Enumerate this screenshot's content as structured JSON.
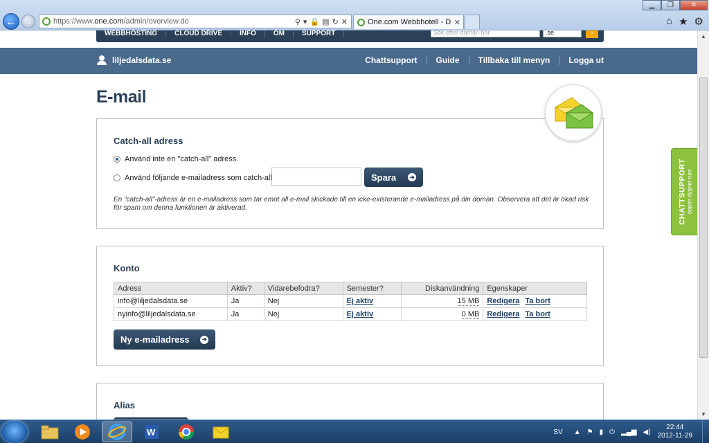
{
  "browser": {
    "url_prefix": "https://www.",
    "url_domain": "one.com",
    "url_path": "/admin/overview.do",
    "tab_title": "One.com Webbhotell - Do...",
    "back_icon": "back-arrow-icon",
    "forward_icon": "forward-arrow-icon"
  },
  "topnav": {
    "items": [
      "WEBBHOSTING",
      "CLOUD DRIVE",
      "INFO",
      "OM",
      "SUPPORT"
    ],
    "search_placeholder": "Sök efter domän här",
    "tld_value": ".se"
  },
  "userbar": {
    "domain": "liljedalsdata.se",
    "links": [
      "Chattsupport",
      "Guide",
      "Tillbaka till menyn",
      "Logga ut"
    ]
  },
  "page": {
    "title": "E-mail"
  },
  "catchall": {
    "heading": "Catch-all adress",
    "option1": "Använd inte en \"catch-all\" adress.",
    "option2": "Använd följande e-mailadress som catch-all",
    "option1_selected": true,
    "input_value": "",
    "save_label": "Spara",
    "note": "En \"catch-all\"-adress är en e-mailadress som tar emot all e-mail skickade till en icke-existerande e-mailadress på din domän. Observera att det är ökad risk för spam om denna funktionen är aktiverad."
  },
  "accounts": {
    "heading": "Konto",
    "columns": [
      "Adress",
      "Aktiv?",
      "Vidarebefodra?",
      "Semester?",
      "Diskanvändning",
      "Egenskaper"
    ],
    "rows": [
      {
        "address": "info@liljedalsdata.se",
        "active": "Ja",
        "forward": "Nej",
        "vacation": "Ej aktiv",
        "disk": "15 MB",
        "edit": "Redigera",
        "delete": "Ta bort"
      },
      {
        "address": "nyinfo@liljedalsdata.se",
        "active": "Ja",
        "forward": "Nej",
        "vacation": "Ej aktiv",
        "disk": "0 MB",
        "edit": "Redigera",
        "delete": "Ta bort"
      }
    ],
    "new_button": "Ny e-mailadress"
  },
  "alias": {
    "heading": "Alias"
  },
  "chat_tab": {
    "title": "CHATTSUPPORT",
    "subtitle": "öppen dygnet runt"
  },
  "taskbar": {
    "language": "SV",
    "time": "22:44",
    "date": "2012-11-29"
  },
  "colors": {
    "brand_dark": "#2b4158",
    "userbar": "#4a6a8c",
    "chat_green": "#8dc23f"
  }
}
